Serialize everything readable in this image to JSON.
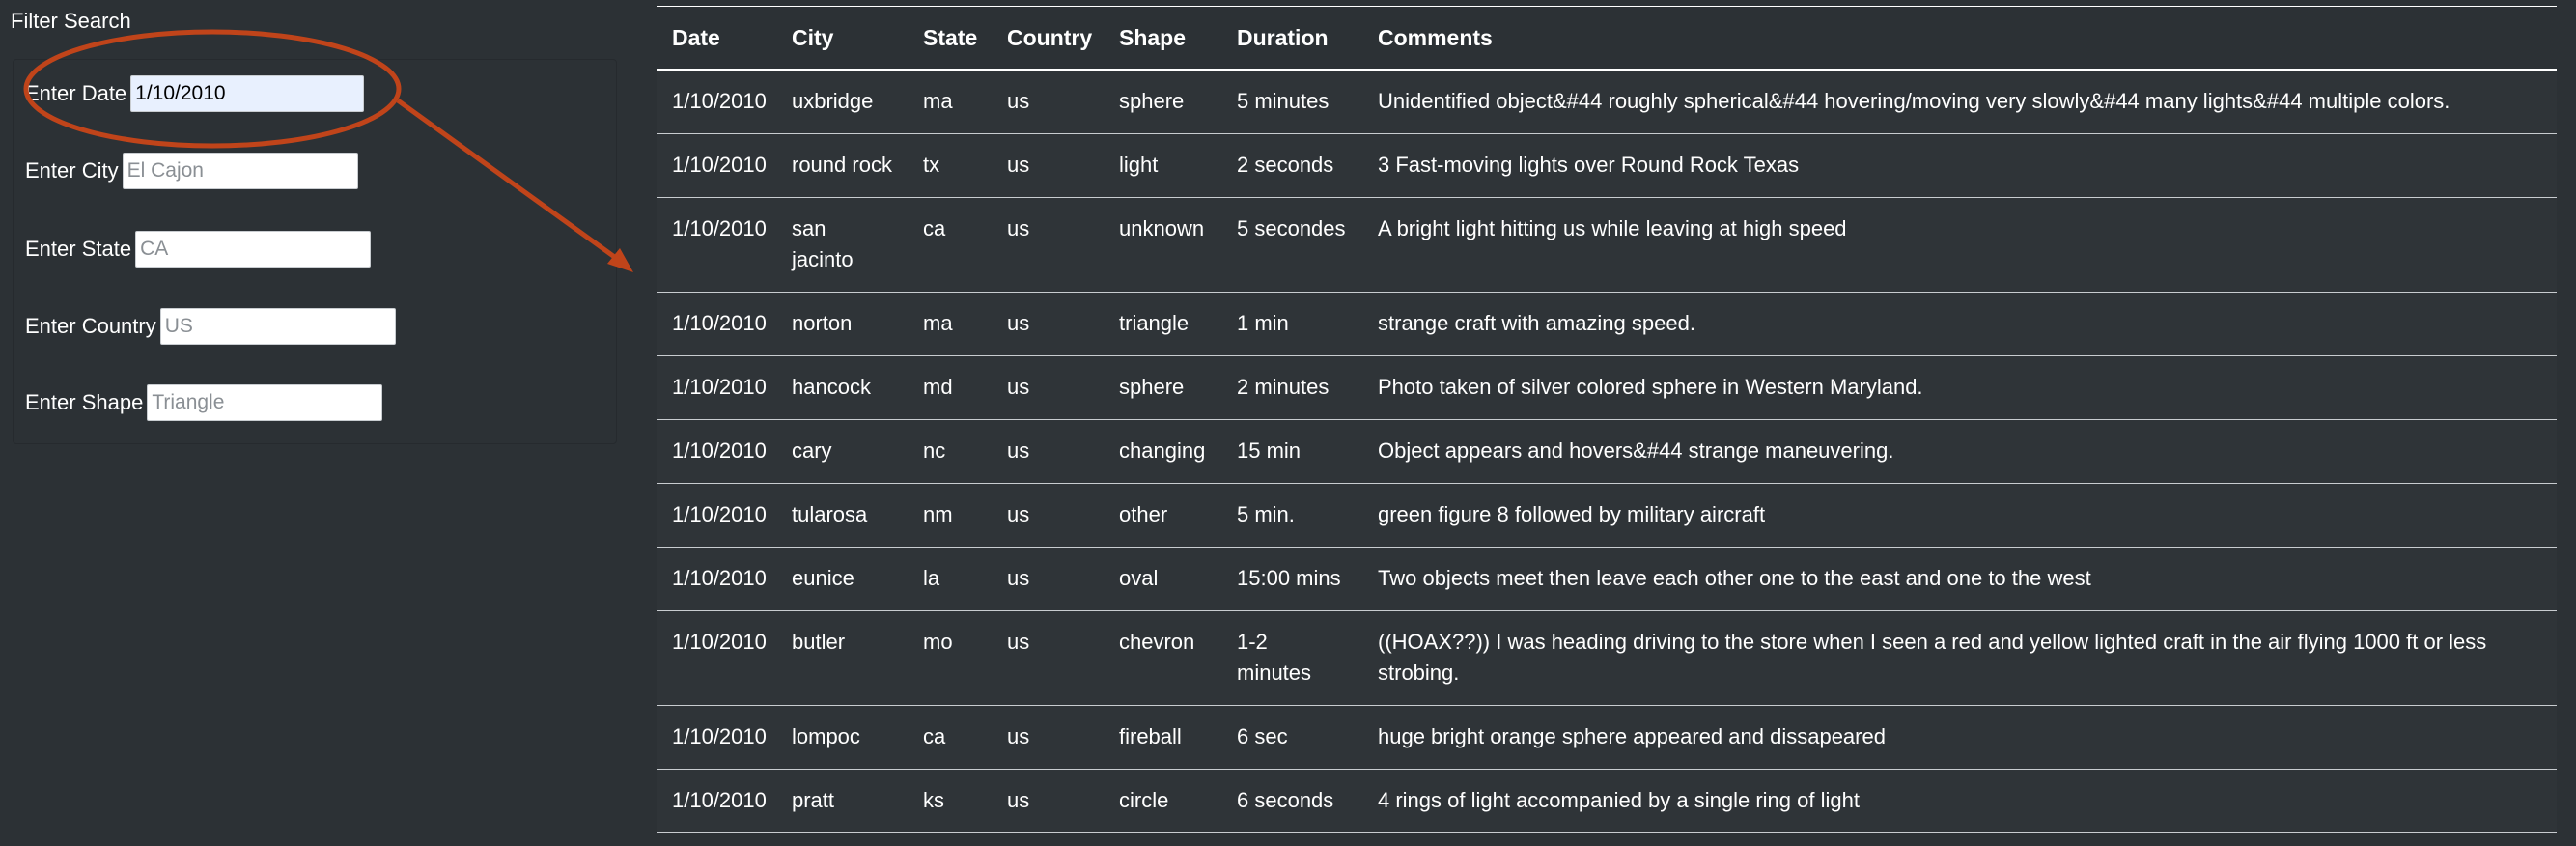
{
  "filter": {
    "title": "Filter Search",
    "fields": [
      {
        "label": "Enter Date",
        "value": "1/10/2010",
        "placeholder": ""
      },
      {
        "label": "Enter City",
        "value": "",
        "placeholder": "El Cajon"
      },
      {
        "label": "Enter State",
        "value": "",
        "placeholder": "CA"
      },
      {
        "label": "Enter Country",
        "value": "",
        "placeholder": "US"
      },
      {
        "label": "Enter Shape",
        "value": "",
        "placeholder": "Triangle"
      }
    ]
  },
  "annotation": {
    "color": "#c0441a"
  },
  "table": {
    "headers": [
      "Date",
      "City",
      "State",
      "Country",
      "Shape",
      "Duration",
      "Comments"
    ],
    "rows": [
      [
        "1/10/2010",
        "uxbridge",
        "ma",
        "us",
        "sphere",
        "5 minutes",
        "Unidentified object&#44 roughly spherical&#44 hovering/moving very slowly&#44 many lights&#44 multiple colors."
      ],
      [
        "1/10/2010",
        "round rock",
        "tx",
        "us",
        "light",
        "2 seconds",
        "3 Fast-moving lights over Round Rock Texas"
      ],
      [
        "1/10/2010",
        "san jacinto",
        "ca",
        "us",
        "unknown",
        "5 secondes",
        "A bright light hitting us while leaving at high speed"
      ],
      [
        "1/10/2010",
        "norton",
        "ma",
        "us",
        "triangle",
        "1 min",
        "strange craft with amazing speed."
      ],
      [
        "1/10/2010",
        "hancock",
        "md",
        "us",
        "sphere",
        "2 minutes",
        "Photo taken of silver colored sphere in Western Maryland."
      ],
      [
        "1/10/2010",
        "cary",
        "nc",
        "us",
        "changing",
        "15 min",
        "Object appears and hovers&#44 strange maneuvering."
      ],
      [
        "1/10/2010",
        "tularosa",
        "nm",
        "us",
        "other",
        "5 min.",
        "green figure 8 followed by military aircraft"
      ],
      [
        "1/10/2010",
        "eunice",
        "la",
        "us",
        "oval",
        "15:00 mins",
        "Two objects meet then leave each other one to the east and one to the west"
      ],
      [
        "1/10/2010",
        "butler",
        "mo",
        "us",
        "chevron",
        "1-2 minutes",
        "((HOAX??)) I was heading driving to the store when I seen a red and yellow lighted craft in the air flying 1000 ft or less strobing."
      ],
      [
        "1/10/2010",
        "lompoc",
        "ca",
        "us",
        "fireball",
        "6 sec",
        "huge bright orange sphere appeared and dissapeared"
      ],
      [
        "1/10/2010",
        "pratt",
        "ks",
        "us",
        "circle",
        "6 seconds",
        "4 rings of light accompanied by a single ring of light"
      ]
    ]
  }
}
